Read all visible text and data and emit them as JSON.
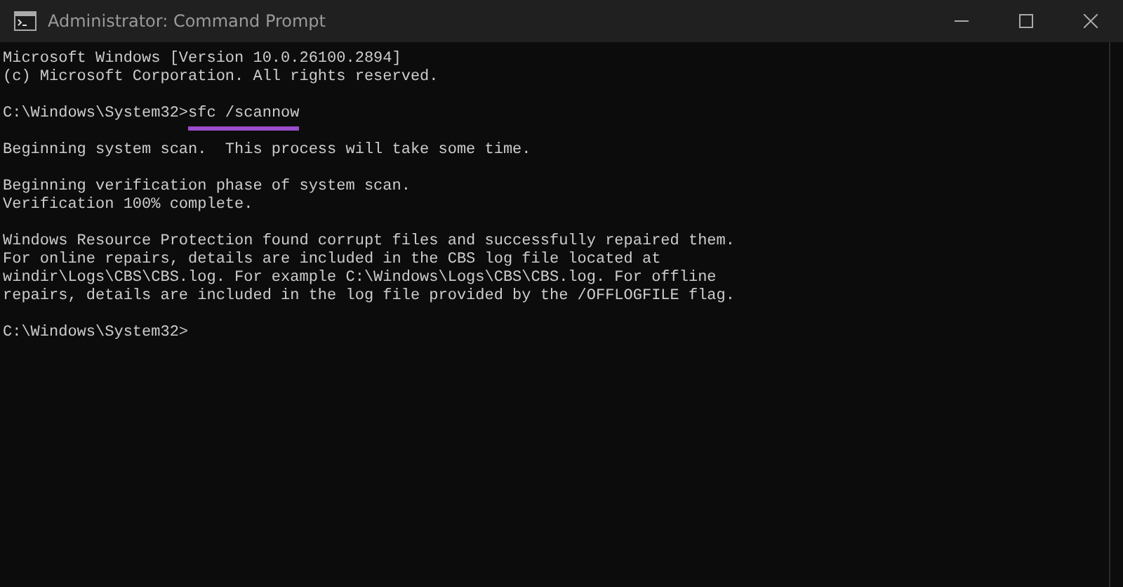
{
  "window": {
    "title": "Administrator: Command Prompt"
  },
  "console": {
    "lines": [
      {
        "kind": "output",
        "text": "Microsoft Windows [Version 10.0.26100.2894]"
      },
      {
        "kind": "output",
        "text": "(c) Microsoft Corporation. All rights reserved."
      },
      {
        "kind": "blank"
      },
      {
        "kind": "prompt",
        "prompt": "C:\\Windows\\System32>",
        "command": "sfc /scannow",
        "underlined": true
      },
      {
        "kind": "blank"
      },
      {
        "kind": "output",
        "text": "Beginning system scan.  This process will take some time."
      },
      {
        "kind": "blank"
      },
      {
        "kind": "output",
        "text": "Beginning verification phase of system scan."
      },
      {
        "kind": "output",
        "text": "Verification 100% complete."
      },
      {
        "kind": "blank"
      },
      {
        "kind": "output",
        "text": "Windows Resource Protection found corrupt files and successfully repaired them."
      },
      {
        "kind": "output",
        "text": "For online repairs, details are included in the CBS log file located at"
      },
      {
        "kind": "output",
        "text": "windir\\Logs\\CBS\\CBS.log. For example C:\\Windows\\Logs\\CBS\\CBS.log. For offline"
      },
      {
        "kind": "output",
        "text": "repairs, details are included in the log file provided by the /OFFLOGFILE flag."
      },
      {
        "kind": "blank"
      },
      {
        "kind": "prompt",
        "prompt": "C:\\Windows\\System32>"
      }
    ]
  }
}
